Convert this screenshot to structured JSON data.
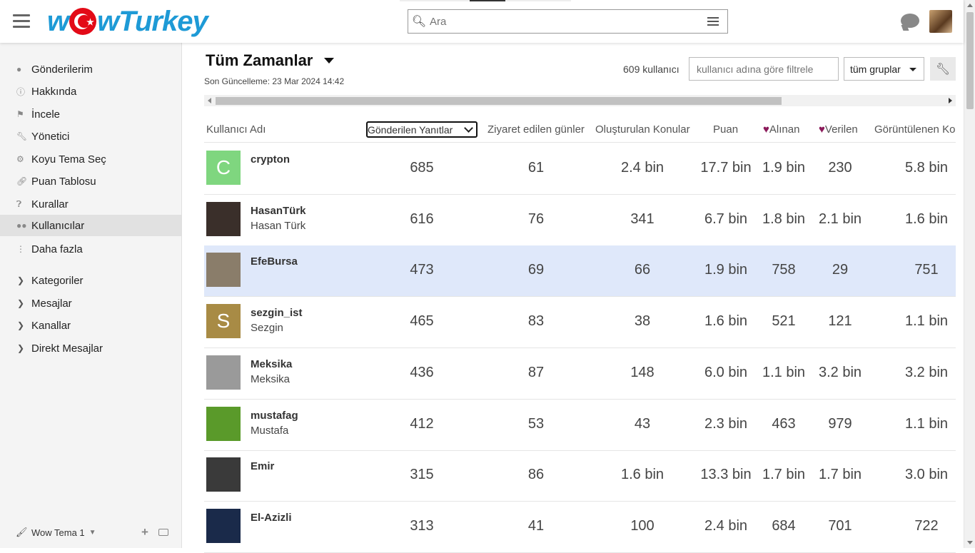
{
  "header": {
    "logo_text": "wowTurkey",
    "search_placeholder": "Ara",
    "search_value": ""
  },
  "sidebar": {
    "items": [
      {
        "label": "Gönderilerim",
        "icon": "user-icon"
      },
      {
        "label": "Hakkında",
        "icon": "info-icon"
      },
      {
        "label": "İncele",
        "icon": "flag-icon"
      },
      {
        "label": "Yönetici",
        "icon": "wrench-icon"
      },
      {
        "label": "Koyu Tema Seç",
        "icon": "gear-icon"
      },
      {
        "label": "Puan Tablosu",
        "icon": "link-icon"
      },
      {
        "label": "Kurallar",
        "icon": "question-icon"
      },
      {
        "label": "Kullanıcılar",
        "icon": "users-icon",
        "active": true
      },
      {
        "label": "Daha fazla",
        "icon": "more-vertical-icon"
      }
    ],
    "sections": [
      {
        "label": "Kategoriler"
      },
      {
        "label": "Mesajlar"
      },
      {
        "label": "Kanallar"
      },
      {
        "label": "Direkt Mesajlar"
      }
    ],
    "footer": {
      "theme_label": "Wow Tema 1"
    }
  },
  "main": {
    "title": "Tüm Zamanlar",
    "updated": "Son Güncelleme: 23 Mar 2024 14:42",
    "user_count": "609 kullanıcı",
    "filter_placeholder": "kullanıcı adına göre filtrele",
    "group_select": "tüm gruplar",
    "columns": {
      "username": "Kullanıcı Adı",
      "replies": "Gönderilen Yanıtlar",
      "days": "Ziyaret edilen günler",
      "topics": "Oluşturulan Konular",
      "points": "Puan",
      "received": "Alınan",
      "given": "Verilen",
      "viewed": "Görüntülenen Ko"
    },
    "rows": [
      {
        "username": "crypton",
        "name": "",
        "avatar_letter": "C",
        "avatar_color": "#7fd67f",
        "replies": "685",
        "days": "61",
        "topics": "2.4 bin",
        "points": "17.7 bin",
        "received": "1.9 bin",
        "given": "230",
        "viewed": "5.8 bin"
      },
      {
        "username": "HasanTürk",
        "name": "Hasan Türk",
        "avatar_letter": "",
        "avatar_color": "#3a2f2a",
        "replies": "616",
        "days": "76",
        "topics": "341",
        "points": "6.7 bin",
        "received": "1.8 bin",
        "given": "2.1 bin",
        "viewed": "1.6 bin"
      },
      {
        "username": "EfeBursa",
        "name": "",
        "avatar_letter": "",
        "avatar_color": "#8a7d6a",
        "replies": "473",
        "days": "69",
        "topics": "66",
        "points": "1.9 bin",
        "received": "758",
        "given": "29",
        "viewed": "751",
        "highlight": true
      },
      {
        "username": "sezgin_ist",
        "name": "Sezgin",
        "avatar_letter": "S",
        "avatar_color": "#a88b45",
        "replies": "465",
        "days": "83",
        "topics": "38",
        "points": "1.6 bin",
        "received": "521",
        "given": "121",
        "viewed": "1.1 bin"
      },
      {
        "username": "Meksika",
        "name": "Meksika",
        "avatar_letter": "",
        "avatar_color": "#9a9a9a",
        "replies": "436",
        "days": "87",
        "topics": "148",
        "points": "6.0 bin",
        "received": "1.1 bin",
        "given": "3.2 bin",
        "viewed": "3.2 bin"
      },
      {
        "username": "mustafag",
        "name": "Mustafa",
        "avatar_letter": "",
        "avatar_color": "#5a9a2a",
        "replies": "412",
        "days": "53",
        "topics": "43",
        "points": "2.3 bin",
        "received": "463",
        "given": "979",
        "viewed": "1.1 bin"
      },
      {
        "username": "Emir",
        "name": "",
        "avatar_letter": "",
        "avatar_color": "#3a3a3a",
        "replies": "315",
        "days": "86",
        "topics": "1.6 bin",
        "points": "13.3 bin",
        "received": "1.7 bin",
        "given": "1.7 bin",
        "viewed": "3.0 bin"
      },
      {
        "username": "El-Azizli",
        "name": "",
        "avatar_letter": "",
        "avatar_color": "#1a2a4a",
        "replies": "313",
        "days": "41",
        "topics": "100",
        "points": "2.4 bin",
        "received": "684",
        "given": "701",
        "viewed": "722"
      }
    ]
  }
}
